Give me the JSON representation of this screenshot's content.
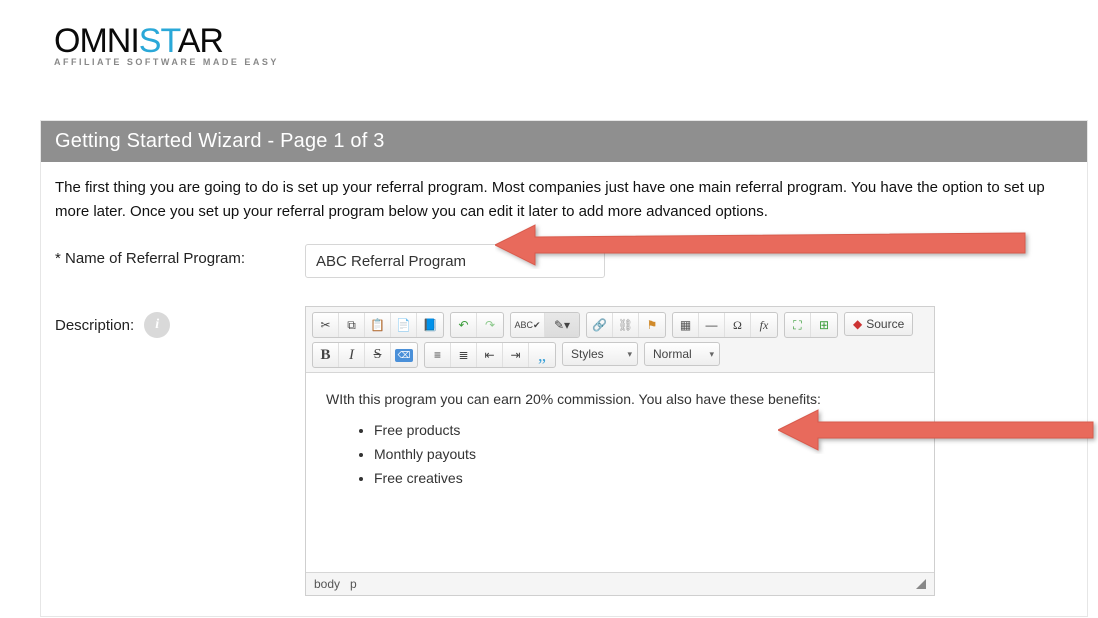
{
  "logo": {
    "text_omni": "OMNI",
    "text_st": "ST",
    "text_ar": "AR",
    "tagline": "AFFILIATE SOFTWARE MADE EASY"
  },
  "wizard": {
    "title": "Getting Started Wizard - Page 1 of 3",
    "intro": "The first thing you are going to do is set up your referral program. Most companies just have one main referral program. You have the option to set up more later. Once you set up your referral program below you can edit it later to add more advanced options."
  },
  "form": {
    "name_label": "* Name of Referral Program:",
    "name_value": "ABC Referral Program",
    "description_label": "Description:",
    "info_glyph": "i"
  },
  "editor": {
    "styles_label": "Styles",
    "format_label": "Normal",
    "source_label": "Source",
    "content_line": "WIth this program you can earn 20% commission. You also have these benefits:",
    "bullets": [
      "Free products",
      "Monthly payouts",
      "Free creatives"
    ],
    "path": {
      "body": "body",
      "p": "p"
    }
  }
}
